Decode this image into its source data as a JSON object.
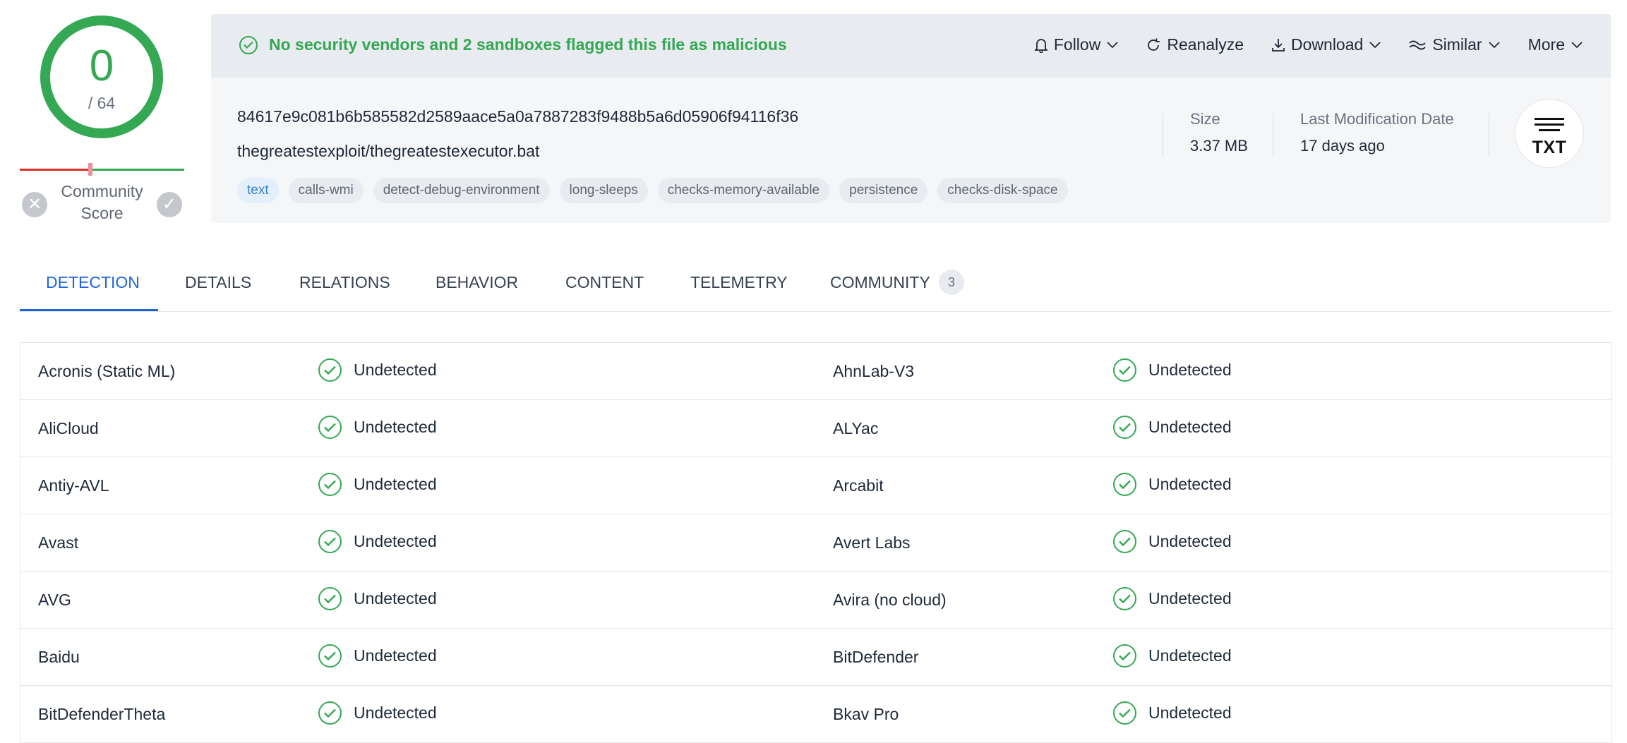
{
  "score": {
    "detections": "0",
    "total": "/ 64",
    "ring_color": "#34a853",
    "community_label": "Community Score",
    "community_negative_icon": "close-icon",
    "community_positive_icon": "check-icon"
  },
  "header": {
    "verdict": "No security vendors and 2 sandboxes flagged this file as malicious",
    "verdict_color": "#34a853",
    "actions": {
      "follow": "Follow",
      "reanalyze": "Reanalyze",
      "download": "Download",
      "similar": "Similar",
      "more": "More"
    },
    "hash": "84617e9c081b6b585582d2589aace5a0a7887283f9488b5a6d05906f94116f36",
    "filename": "thegreatestexploit/thegreatestexecutor.bat",
    "tags": [
      "text",
      "calls-wmi",
      "detect-debug-environment",
      "long-sleeps",
      "checks-memory-available",
      "persistence",
      "checks-disk-space"
    ],
    "size_label": "Size",
    "size_value": "3.37 MB",
    "modified_label": "Last Modification Date",
    "modified_value": "17 days ago",
    "filetype": "TXT"
  },
  "tabs": {
    "detection": "DETECTION",
    "details": "DETAILS",
    "relations": "RELATIONS",
    "behavior": "BEHAVIOR",
    "content": "CONTENT",
    "telemetry": "TELEMETRY",
    "community": "COMMUNITY",
    "community_count": "3"
  },
  "results": [
    {
      "left_vendor": "Acronis (Static ML)",
      "left_result": "Undetected",
      "right_vendor": "AhnLab-V3",
      "right_result": "Undetected"
    },
    {
      "left_vendor": "AliCloud",
      "left_result": "Undetected",
      "right_vendor": "ALYac",
      "right_result": "Undetected"
    },
    {
      "left_vendor": "Antiy-AVL",
      "left_result": "Undetected",
      "right_vendor": "Arcabit",
      "right_result": "Undetected"
    },
    {
      "left_vendor": "Avast",
      "left_result": "Undetected",
      "right_vendor": "Avert Labs",
      "right_result": "Undetected"
    },
    {
      "left_vendor": "AVG",
      "left_result": "Undetected",
      "right_vendor": "Avira (no cloud)",
      "right_result": "Undetected"
    },
    {
      "left_vendor": "Baidu",
      "left_result": "Undetected",
      "right_vendor": "BitDefender",
      "right_result": "Undetected"
    },
    {
      "left_vendor": "BitDefenderTheta",
      "left_result": "Undetected",
      "right_vendor": "Bkav Pro",
      "right_result": "Undetected"
    }
  ]
}
